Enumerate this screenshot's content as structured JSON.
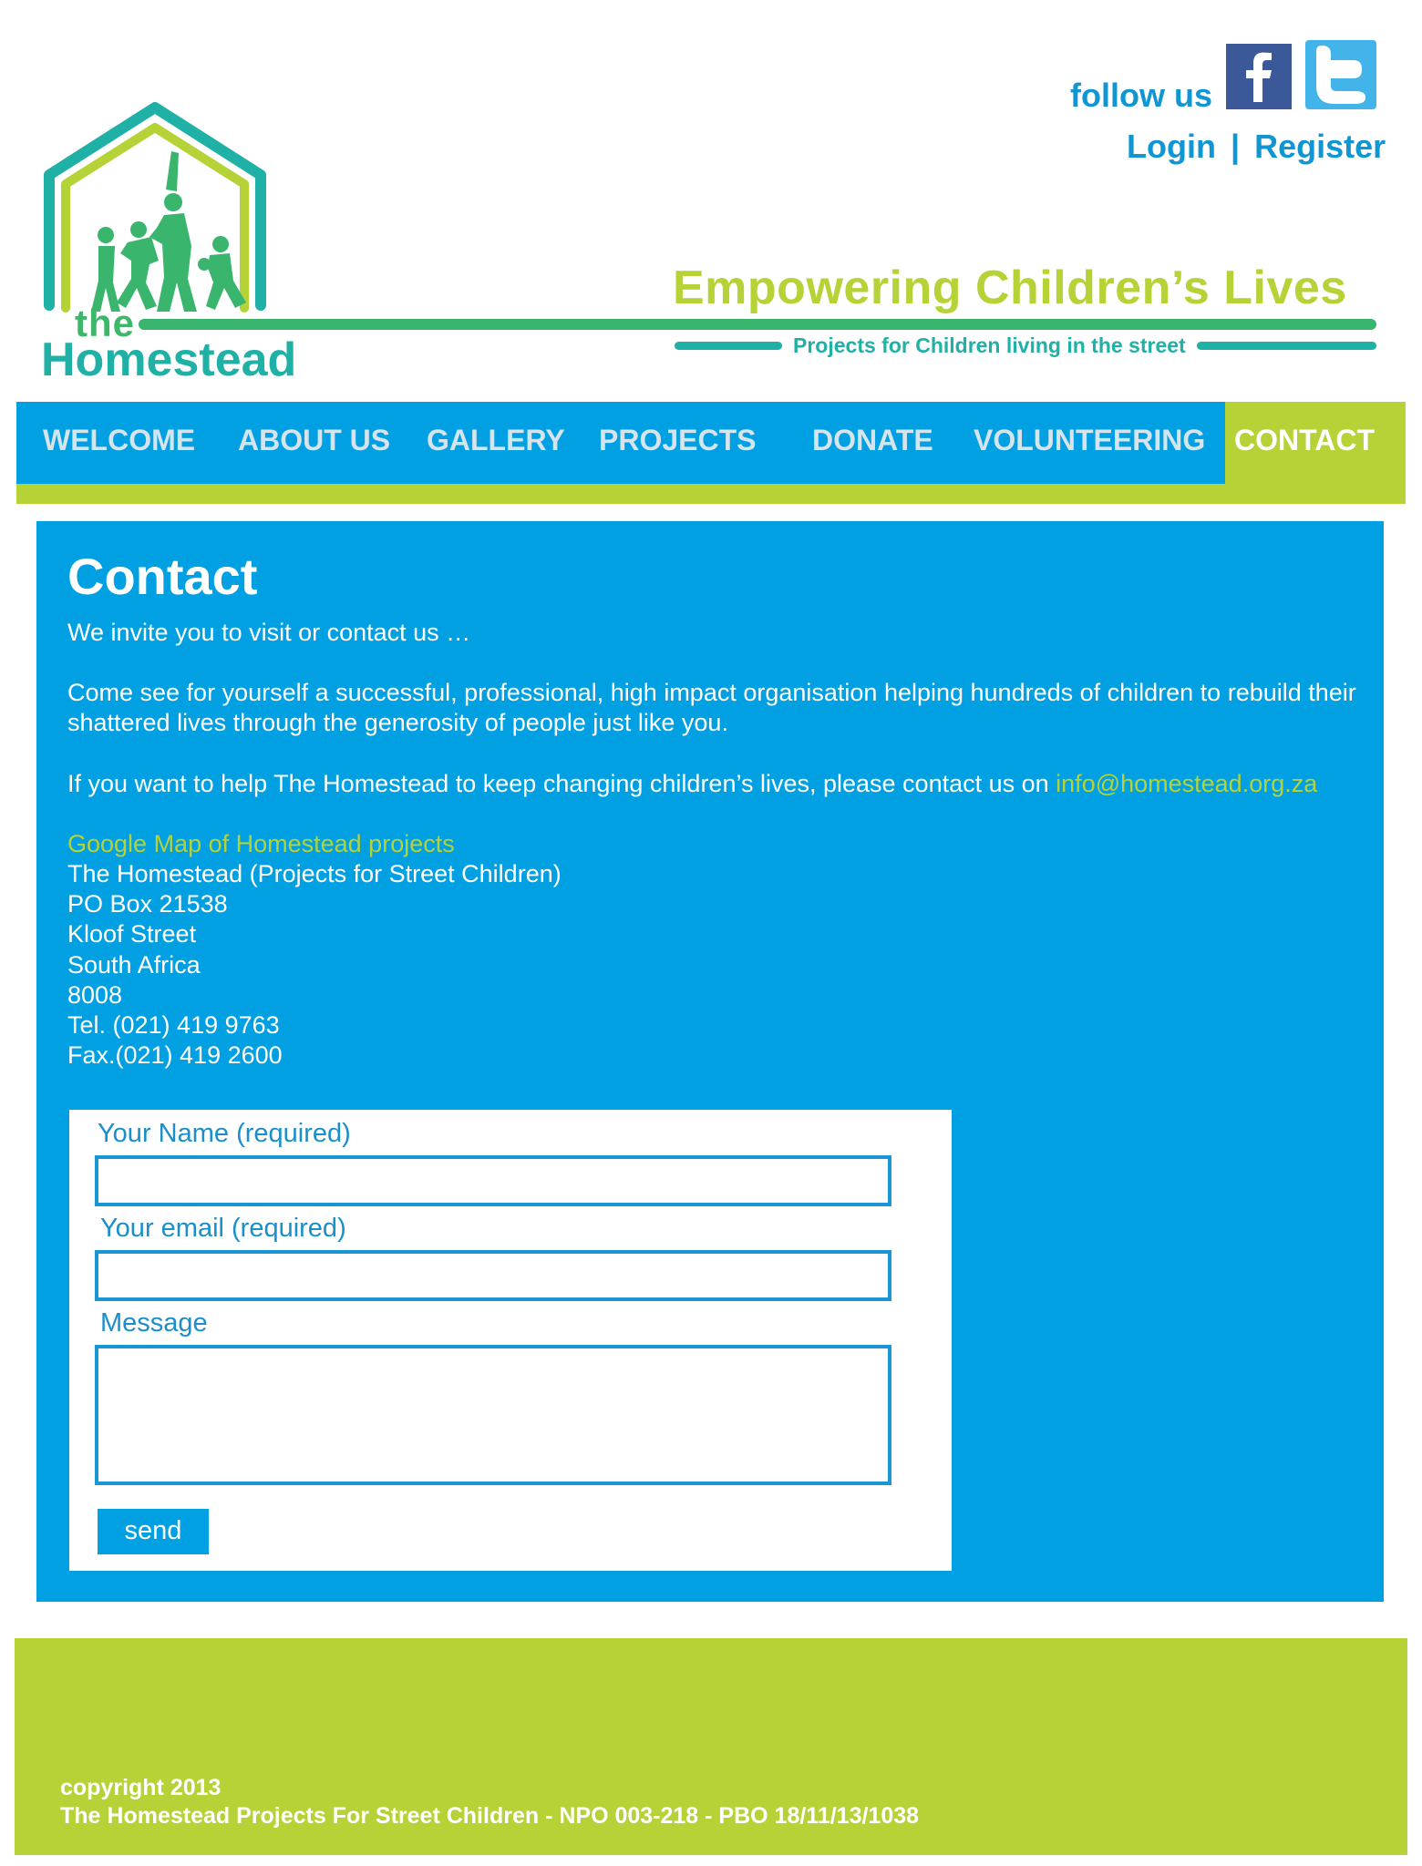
{
  "header": {
    "logo": {
      "line1": "the",
      "line2": "Homestead"
    },
    "tagline": "Empowering Children’s Lives",
    "subtagline": "Projects for Children living in the street",
    "follow_us": "follow us",
    "social_icons": [
      "facebook-icon",
      "twitter-icon"
    ],
    "login": "Login",
    "separator": "|",
    "register": "Register"
  },
  "nav": {
    "items": [
      {
        "label": "WELCOME"
      },
      {
        "label": "ABOUT US"
      },
      {
        "label": "GALLERY"
      },
      {
        "label": "PROJECTS"
      },
      {
        "label": "DONATE"
      },
      {
        "label": "VOLUNTEERING"
      },
      {
        "label": "CONTACT",
        "active": true
      }
    ]
  },
  "main": {
    "title": "Contact",
    "intro": "We invite you to visit or contact us …",
    "paragraph1": "Come see for yourself  a successful, professional, high impact organisation helping  hundreds of children to rebuild their shattered lives through the generosity of people just  like you.",
    "paragraph2_prefix": "If you want to help The Homestead to keep changing children’s lives, please contact us on ",
    "email": "info@homestead.org.za",
    "map_link": "Google Map of Homestead projects",
    "address": [
      "The Homestead (Projects for Street Children)",
      "PO Box 21538",
      "Kloof Street",
      "South Africa",
      "8008",
      "Tel. (021) 419 9763",
      "Fax.(021) 419 2600"
    ]
  },
  "form": {
    "name_label": "Your Name (required)",
    "name_value": "",
    "email_label": "Your email (required)",
    "email_value": "",
    "message_label": "Message",
    "message_value": "",
    "send_label": "send"
  },
  "footer": {
    "copyright": "copyright 2013",
    "org_line": "The Homestead Projects For Street Children - NPO 003-218 - PBO 18/11/13/1038"
  },
  "colors": {
    "blue": "#01a0e2",
    "lime": "#b5d336",
    "green": "#3ab56e",
    "teal": "#1fb0a6",
    "facebook": "#3b5998",
    "twitter": "#43b4ea"
  }
}
